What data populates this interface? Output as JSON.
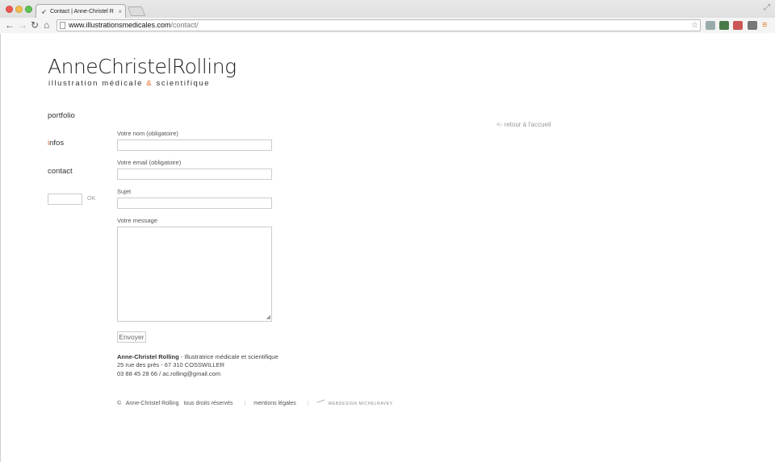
{
  "browser": {
    "tab_title": "Contact | Anne-Christel R",
    "tab_close": "×",
    "url_host": "www.illustrationsmedicales.com",
    "url_path": "/contact/",
    "icons": [
      "back-icon",
      "forward-icon",
      "reload-icon",
      "home-icon",
      "star-icon",
      "menu-icon"
    ]
  },
  "logo": {
    "name": "AnneChristelRolling",
    "sub_before": "illustration médicale ",
    "sub_amp": "&",
    "sub_after": " scientifique",
    "amp_color": "#e36b27"
  },
  "nav": {
    "portfolio": "portfolio",
    "infos_first": "i",
    "infos_rest": "nfos",
    "contact": "contact"
  },
  "search": {
    "ok": "OK"
  },
  "back_link": "<- retour à l'accueil",
  "form": {
    "name_label": "Votre nom (obligatoire)",
    "email_label": "Votre email (obligatoire)",
    "subject_label": "Sujet",
    "message_label": "Votre message",
    "submit": "Envoyer"
  },
  "address": {
    "name": "Anne-Christel Rolling",
    "title": " -  Illustratrice médicale et scientifique",
    "street": "25 rue des prés  -  67 310 COSSWILLER",
    "contact": "03 88 45 28 66   /   ac.rolling@gmail.com"
  },
  "footer": {
    "copyright": "©",
    "owner": "Anne-Christel Rolling",
    "rights": "tous droits réservés",
    "legal": "mentions légales",
    "webdesign": "WEBDESIGN  MICHELRAVEY"
  }
}
